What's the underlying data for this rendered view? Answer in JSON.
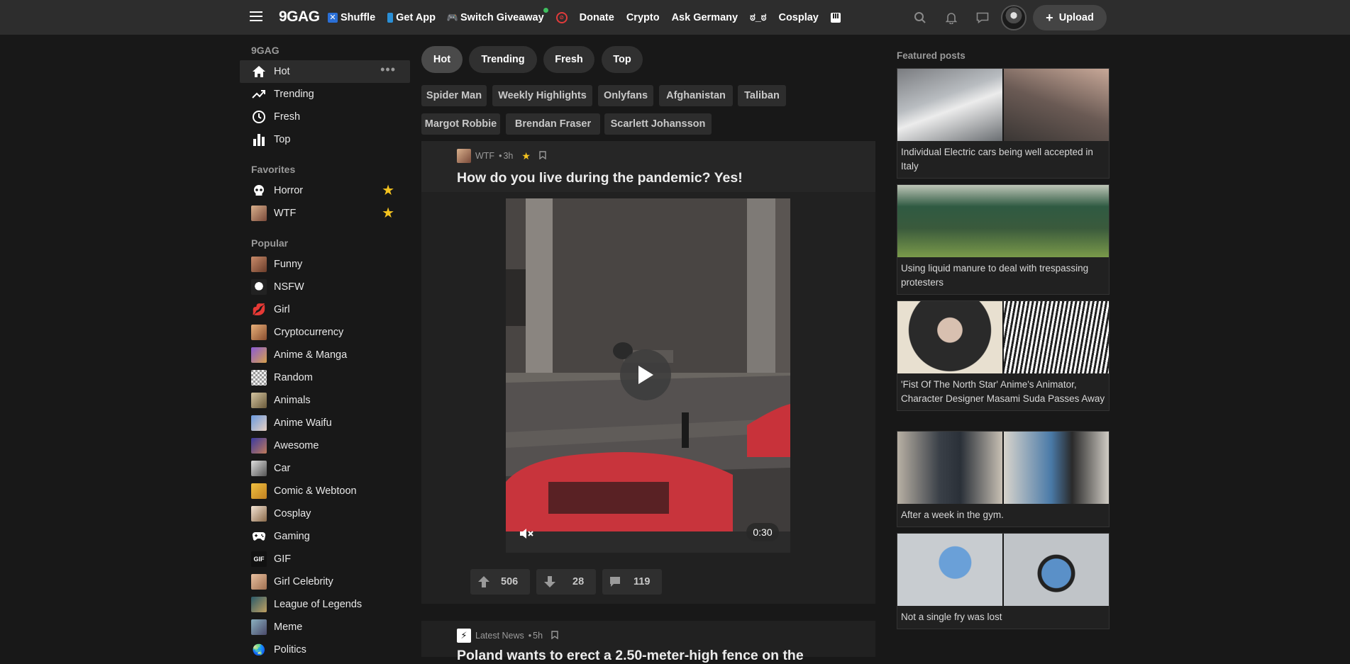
{
  "header": {
    "logo": "9GAG",
    "links": [
      {
        "label": "Shuffle",
        "icon": "shuffle-icon"
      },
      {
        "label": "Get App",
        "icon": "phone-icon"
      },
      {
        "label": "Switch Giveaway",
        "icon": "gamepad-icon"
      },
      {
        "label": "",
        "icon": "no-ads-icon"
      },
      {
        "label": "Donate",
        "icon": ""
      },
      {
        "label": "Crypto",
        "icon": ""
      },
      {
        "label": "Ask Germany",
        "icon": ""
      },
      {
        "label": "ಠ_ಠ",
        "icon": ""
      },
      {
        "label": "Cosplay",
        "icon": ""
      },
      {
        "label": "",
        "icon": "piano-icon"
      }
    ],
    "upload_label": "Upload"
  },
  "sidebar": {
    "section_9gag": "9GAG",
    "main_items": [
      {
        "label": "Hot",
        "icon": "home-icon"
      },
      {
        "label": "Trending",
        "icon": "trending-icon"
      },
      {
        "label": "Fresh",
        "icon": "clock-icon"
      },
      {
        "label": "Top",
        "icon": "bar-chart-icon"
      }
    ],
    "section_favorites": "Favorites",
    "favorites": [
      {
        "label": "Horror",
        "icon": "skull-icon"
      },
      {
        "label": "WTF",
        "icon": "wtf-thumb"
      }
    ],
    "section_popular": "Popular",
    "popular": [
      {
        "label": "Funny"
      },
      {
        "label": "NSFW"
      },
      {
        "label": "Girl"
      },
      {
        "label": "Cryptocurrency"
      },
      {
        "label": "Anime & Manga"
      },
      {
        "label": "Random"
      },
      {
        "label": "Animals"
      },
      {
        "label": "Anime Waifu"
      },
      {
        "label": "Awesome"
      },
      {
        "label": "Car"
      },
      {
        "label": "Comic & Webtoon"
      },
      {
        "label": "Cosplay"
      },
      {
        "label": "Gaming"
      },
      {
        "label": "GIF"
      },
      {
        "label": "Girl Celebrity"
      },
      {
        "label": "League of Legends"
      },
      {
        "label": "Meme"
      },
      {
        "label": "Politics"
      }
    ],
    "gif_icon_text": "GIF"
  },
  "main": {
    "tabs": [
      "Hot",
      "Trending",
      "Fresh",
      "Top"
    ],
    "tags_row1": [
      "Spider Man",
      "Weekly Highlights",
      "Onlyfans",
      "Afghanistan",
      "Taliban"
    ],
    "tags_row2": [
      "Margot Robbie",
      "Brendan Fraser",
      "Scarlett Johansson"
    ],
    "post1": {
      "section": "WTF",
      "age": "3h",
      "title": "How do you live during the pandemic? Yes!",
      "duration": "0:30",
      "upvotes": "506",
      "downvotes": "28",
      "comments": "119"
    },
    "post2": {
      "section": "Latest News",
      "age": "5h",
      "title": "Poland wants to erect a 2.50-meter-high fence on the"
    }
  },
  "featured": {
    "title": "Featured posts",
    "items": [
      {
        "caption": "Individual Electric cars being well accepted in Italy"
      },
      {
        "caption": "Using liquid manure to deal with trespassing protesters"
      },
      {
        "caption": "'Fist Of The North Star' Anime's Animator, Character Designer Masami Suda Passes Away"
      },
      {
        "caption": "After a week in the gym."
      },
      {
        "caption": "Not a single fry was lost"
      }
    ]
  },
  "colors": {
    "background": "#181818",
    "header": "#2d2d2d",
    "card": "#212121",
    "star": "#f4c31f",
    "notification_dot": "#3fbf5f"
  }
}
